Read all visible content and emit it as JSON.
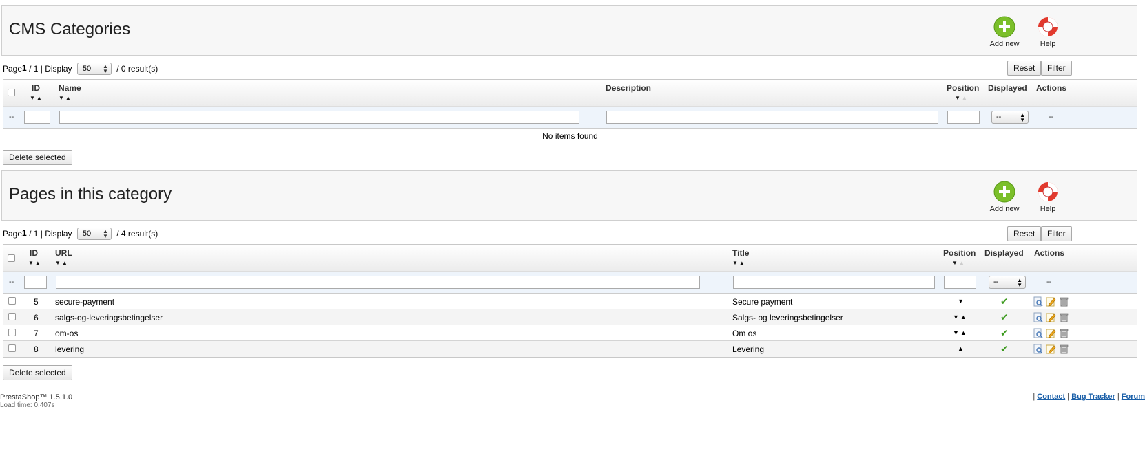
{
  "cms_categories": {
    "title": "CMS Categories",
    "add_new": "Add new",
    "help": "Help",
    "pager": {
      "page_word": "Page",
      "page": "1",
      "of": "/ 1 | Display",
      "per_page": "50",
      "results": "/ 0 result(s)"
    },
    "reset": "Reset",
    "filter": "Filter",
    "columns": {
      "id": "ID",
      "name": "Name",
      "description": "Description",
      "position": "Position",
      "displayed": "Displayed",
      "actions": "Actions"
    },
    "filter_row": {
      "dash": "--",
      "displayed_select": "--",
      "actions_dash": "--"
    },
    "empty": "No items found",
    "delete_selected": "Delete selected"
  },
  "pages": {
    "title": "Pages in this category",
    "add_new": "Add new",
    "help": "Help",
    "pager": {
      "page_word": "Page",
      "page": "1",
      "of": "/ 1 | Display",
      "per_page": "50",
      "results": "/ 4 result(s)"
    },
    "reset": "Reset",
    "filter": "Filter",
    "columns": {
      "id": "ID",
      "url": "URL",
      "title": "Title",
      "position": "Position",
      "displayed": "Displayed",
      "actions": "Actions"
    },
    "filter_row": {
      "dash": "--",
      "displayed_select": "--",
      "actions_dash": "--"
    },
    "rows": [
      {
        "id": "5",
        "url": "secure-payment",
        "title": "Secure payment",
        "position": "down"
      },
      {
        "id": "6",
        "url": "salgs-og-leveringsbetingelser",
        "title": "Salgs- og leveringsbetingelser",
        "position": "both"
      },
      {
        "id": "7",
        "url": "om-os",
        "title": "Om os",
        "position": "both"
      },
      {
        "id": "8",
        "url": "levering",
        "title": "Levering",
        "position": "up"
      }
    ],
    "delete_selected": "Delete selected"
  },
  "footer": {
    "version": "PrestaShop™ 1.5.1.0",
    "load_time": "Load time: 0.407s",
    "sep": "|",
    "links": [
      "Contact",
      "Bug Tracker",
      "Forum"
    ]
  },
  "colors": {
    "accent_green": "#3c9a1e",
    "link_blue": "#1a5fa8"
  },
  "icons": {
    "add": "plus-circle-icon",
    "help": "lifebuoy-icon",
    "check": "check-icon",
    "view": "view-icon",
    "edit": "edit-icon",
    "delete": "trash-icon"
  }
}
